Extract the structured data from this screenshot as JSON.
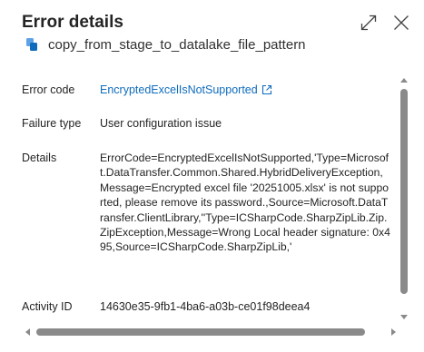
{
  "dialog": {
    "title": "Error details",
    "pipeline_name": "copy_from_stage_to_datalake_file_pattern"
  },
  "fields": {
    "error_code": {
      "label": "Error code",
      "value": "EncryptedExcelIsNotSupported"
    },
    "failure_type": {
      "label": "Failure type",
      "value": "User configuration issue"
    },
    "details": {
      "label": "Details",
      "value": "ErrorCode=EncryptedExcelIsNotSupported,'Type=Microsoft.DataTransfer.Common.Shared.HybridDeliveryException,Message=Encrypted excel file '20251005.xlsx' is not supported, please remove its password.,Source=Microsoft.DataTransfer.ClientLibrary,''Type=ICSharpCode.SharpZipLib.Zip.ZipException,Message=Wrong Local header signature: 0x495,Source=ICSharpCode.SharpZipLib,'"
    },
    "activity_id": {
      "label": "Activity ID",
      "value": "14630e35-9fb1-4ba6-a03b-ce01f98deea4"
    }
  },
  "icons": {
    "expand": "expand-icon",
    "close": "close-icon",
    "pipeline": "pipeline-icon",
    "open_external": "open-external-icon"
  },
  "colors": {
    "link": "#0f6cbd",
    "pipeline_icon": "#0f6cbd",
    "scrollbar": "#8a8a8a"
  }
}
